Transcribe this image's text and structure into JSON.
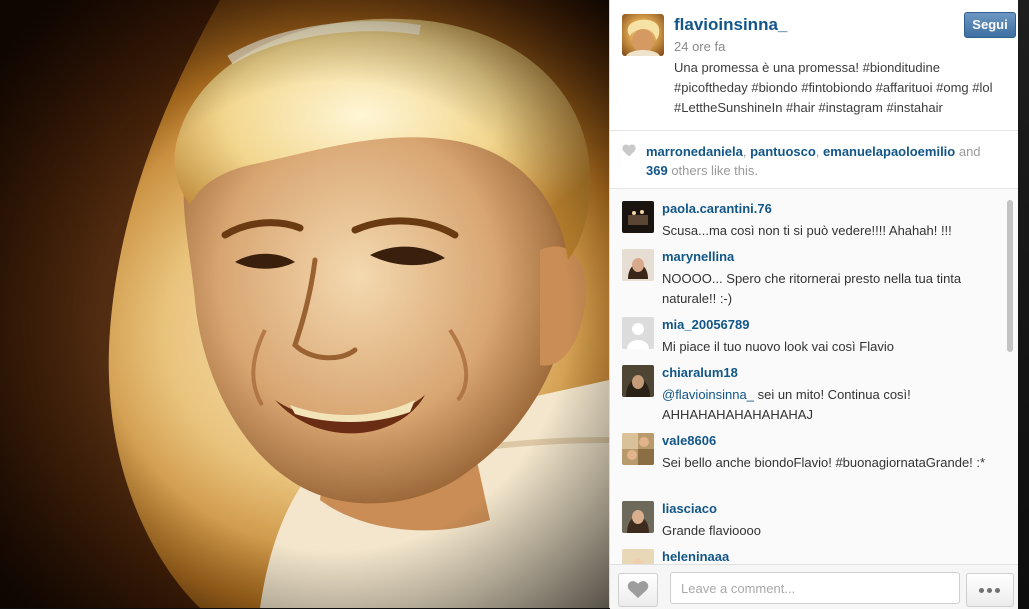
{
  "post": {
    "owner_username": "flavioinsinna_",
    "time_ago": "24 ore fa",
    "follow_label": "Segui",
    "caption": "Una promessa è una promessa! #bionditudine #picoftheday #biondo #fintobiondo #affarituoi #omg #lol #LettheSunshineIn #hair #instagram #instahair"
  },
  "likes": {
    "users": [
      "marronedaniela",
      "pantuosco",
      "emanuelapaoloemilio"
    ],
    "sep1": ", ",
    "sep2": ", ",
    "and_text": " and ",
    "count": "369",
    "suffix": " others like this."
  },
  "comments": [
    {
      "username": "paola.carantini.76",
      "text": "Scusa...ma così non ti si può vedere!!!! Ahahah! !!!"
    },
    {
      "username": "marynellina",
      "text": "NOOOO... Spero che ritornerai presto nella tua tinta naturale!! :-)"
    },
    {
      "username": "mia_20056789",
      "text": "Mi piace il tuo nuovo look vai così Flavio"
    },
    {
      "username": "chiaralum18",
      "mention": "@flavioinsinna_",
      "text": " sei un mito! Continua così! AHHAHAHAHAHAHAHAJ"
    },
    {
      "username": "vale8606",
      "text": "Sei bello anche biondoFlavio! #buonagiornataGrande! :*"
    },
    {
      "username": "liasciaco",
      "text": "Grande flavioooo"
    },
    {
      "username": "heleninaaa",
      "text": ""
    }
  ],
  "footer": {
    "comment_placeholder": "Leave a comment..."
  },
  "colors": {
    "username_blue": "#125688",
    "follow_button": "#3d6fa1"
  },
  "icons": [
    "heart-icon",
    "more-dots-icon"
  ]
}
